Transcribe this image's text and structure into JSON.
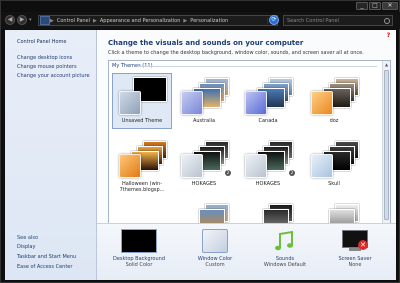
{
  "window": {
    "minimize": "_",
    "maximize": "□",
    "close": "✕"
  },
  "nav": {
    "back": "◀",
    "forward": "▶",
    "breadcrumbs": [
      "Control Panel",
      "Appearance and Personalization",
      "Personalization"
    ],
    "separator": "▶",
    "search_placeholder": "Search Control Panel",
    "refresh": "⟳"
  },
  "sidebar": {
    "home": "Control Panel Home",
    "links": [
      "Change desktop icons",
      "Change mouse pointers",
      "Change your account picture"
    ],
    "see_also": "See also",
    "see_also_links": [
      "Display",
      "Taskbar and Start Menu",
      "Ease of Access Center"
    ]
  },
  "main": {
    "title": "Change the visuals and sounds on your computer",
    "description": "Click a theme to change the desktop background, window color, sounds, and screen saver all at once.",
    "help": "?",
    "group_label": "My Themes (11)",
    "themes": [
      {
        "label": "Unsaved Theme",
        "selected": true
      },
      {
        "label": "Australia"
      },
      {
        "label": "Canada"
      },
      {
        "label": "doz"
      },
      {
        "label": "Halloween (win-7themes.blogsp...",
        "two_line": true
      },
      {
        "label": "HOKAGES",
        "badge": "2"
      },
      {
        "label": "HOKAGES",
        "badge": "2"
      },
      {
        "label": "Skull"
      }
    ]
  },
  "bottom": {
    "items": [
      {
        "label": "Desktop Background",
        "sub": "Solid Color"
      },
      {
        "label": "Window Color",
        "sub": "Custom"
      },
      {
        "label": "Sounds",
        "sub": "Windows Default"
      },
      {
        "label": "Screen Saver",
        "sub": "None"
      }
    ]
  },
  "colors": {
    "accent": "#1e3d73",
    "sidebar_bg": "#e8eef8",
    "frame": "#0e0e0e"
  }
}
